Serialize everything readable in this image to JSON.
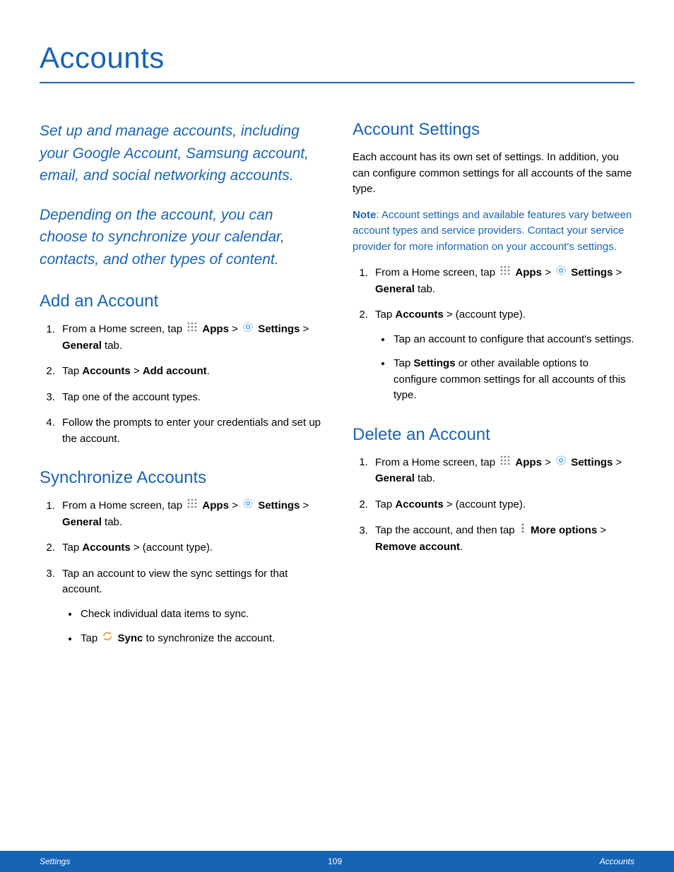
{
  "title": "Accounts",
  "intro1": "Set up and manage accounts, including your Google Account, Samsung account, email, and social networking accounts.",
  "intro2": "Depending on the account, you can choose to synchronize your calendar, contacts, and other types of content.",
  "icons": {
    "apps": "Apps",
    "settings": "Settings",
    "sync": "Sync",
    "more": "More options"
  },
  "common": {
    "from_home_prefix": "From a Home screen, tap ",
    "sep": " > ",
    "general_suffix": " tab.",
    "general_label": "General",
    "accounts_label": "Accounts",
    "account_type_suffix": " > (account type)."
  },
  "add": {
    "heading": "Add an Account",
    "step2_prefix": "Tap ",
    "step2_add": "Add account",
    "step3": "Tap one of the account types.",
    "step4": "Follow the prompts to enter your credentials and set up the account."
  },
  "sync": {
    "heading": "Synchronize Accounts",
    "step2_prefix": "Tap ",
    "step3": "Tap an account to view the sync settings for that account.",
    "bullet1": "Check individual data items to sync.",
    "bullet2_prefix": "Tap ",
    "bullet2_suffix": " to synchronize the account."
  },
  "acct_settings": {
    "heading": "Account Settings",
    "para": "Each account has its own set of settings. In addition, you can configure common settings for all accounts of the same type.",
    "note_label": "Note",
    "note_body": ": Account settings and available features vary between account types and service providers. Contact your service provider for more information on your account's settings.",
    "step2_prefix": "Tap ",
    "bullet1": "Tap an account to configure that account's settings.",
    "bullet2_prefix": "Tap ",
    "bullet2_label": "Settings",
    "bullet2_suffix": " or other available options to configure common settings for all accounts of this type."
  },
  "delete": {
    "heading": "Delete an Account",
    "step2_prefix": "Tap ",
    "step3_prefix": "Tap the account, and then tap ",
    "step3_sep": " > ",
    "step3_remove": "Remove account",
    "step3_end": "."
  },
  "footer": {
    "left": "Settings",
    "center": "109",
    "right": "Accounts"
  }
}
